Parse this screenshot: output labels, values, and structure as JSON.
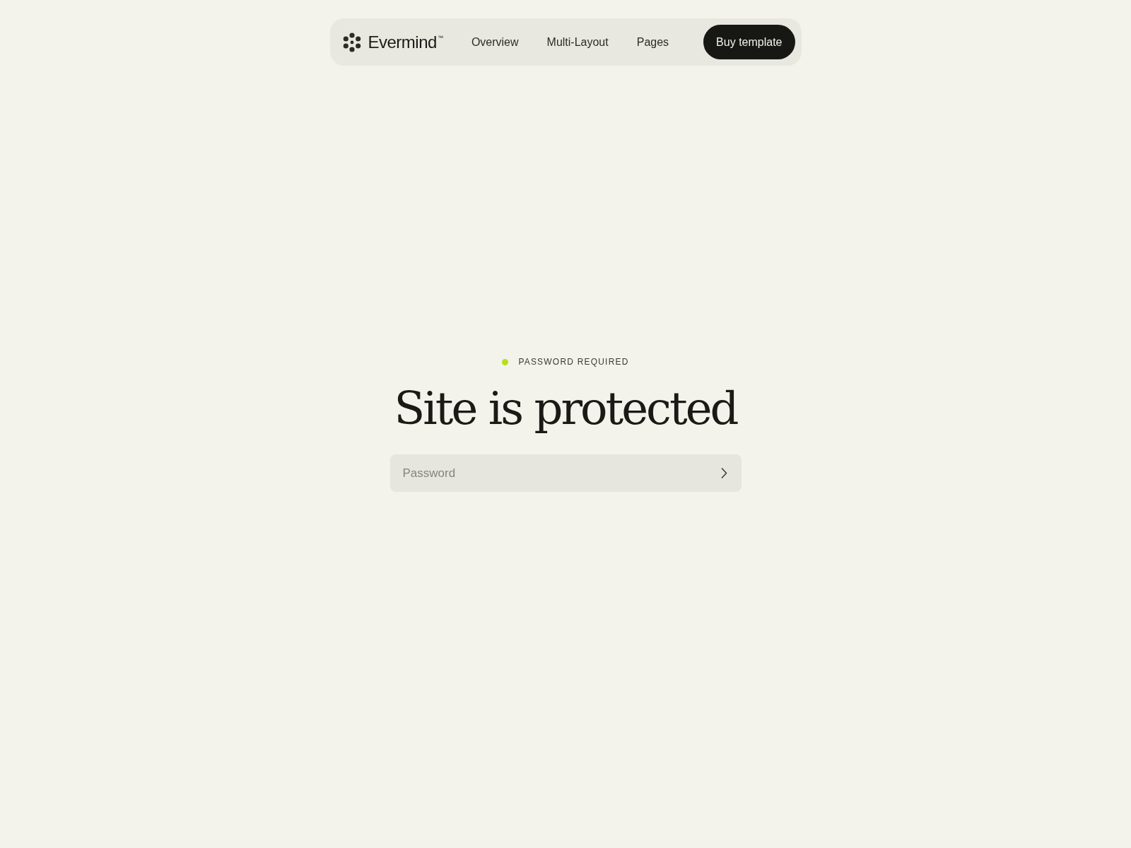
{
  "nav": {
    "brand": "Evermind",
    "trademark": "™",
    "links": [
      "Overview",
      "Multi-Layout",
      "Pages"
    ],
    "cta": "Buy template"
  },
  "status": {
    "label": "PASSWORD REQUIRED",
    "color": "#b6e01c"
  },
  "heading": "Site is protected",
  "password_field": {
    "placeholder": "Password"
  }
}
